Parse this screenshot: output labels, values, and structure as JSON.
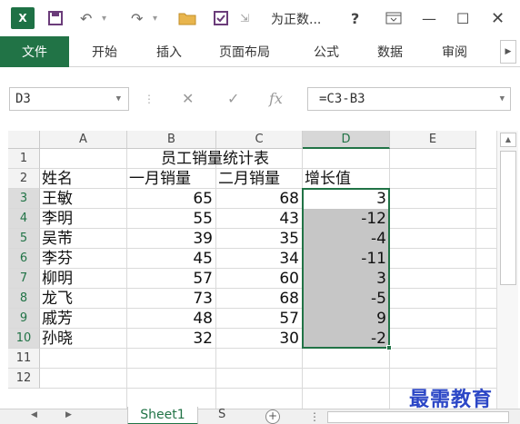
{
  "titlebar": {
    "app_logo": "X",
    "title": "为正数...",
    "help": "?",
    "icons": [
      "save-icon",
      "undo-icon",
      "redo-icon",
      "open-folder-icon",
      "form-icon",
      "customize-icon",
      "ribbon-display-icon",
      "minimize-icon",
      "maximize-icon",
      "close-icon"
    ]
  },
  "ribbon": {
    "file_tab": "文件",
    "tabs": [
      "开始",
      "插入",
      "页面布局",
      "公式",
      "数据",
      "审阅"
    ]
  },
  "formula_bar": {
    "name_box": "D3",
    "fx": "fx",
    "formula": "=C3-B3"
  },
  "sheet": {
    "columns": [
      "A",
      "B",
      "C",
      "D",
      "E"
    ],
    "rows": [
      "1",
      "2",
      "3",
      "4",
      "5",
      "6",
      "7",
      "8",
      "9",
      "10",
      "11",
      "12"
    ],
    "title": "员工销量统计表",
    "headers": [
      "姓名",
      "一月销量",
      "二月销量",
      "增长值"
    ],
    "data": [
      [
        "王敏",
        "65",
        "68",
        "3"
      ],
      [
        "李明",
        "55",
        "43",
        "-12"
      ],
      [
        "吴芾",
        "39",
        "35",
        "-4"
      ],
      [
        "李芬",
        "45",
        "34",
        "-11"
      ],
      [
        "柳明",
        "57",
        "60",
        "3"
      ],
      [
        "龙飞",
        "73",
        "68",
        "-5"
      ],
      [
        "戚芳",
        "48",
        "57",
        "9"
      ],
      [
        "孙晓",
        "32",
        "30",
        "-2"
      ]
    ],
    "selected_column": "D"
  },
  "tabs_bar": {
    "sheet_name": "Sheet1",
    "ellipsis": "S",
    "add": "+"
  },
  "watermark": "最需教育",
  "colors": {
    "accent": "#217346",
    "selection_fill": "#c6c6c6",
    "watermark": "#2c47c6"
  }
}
